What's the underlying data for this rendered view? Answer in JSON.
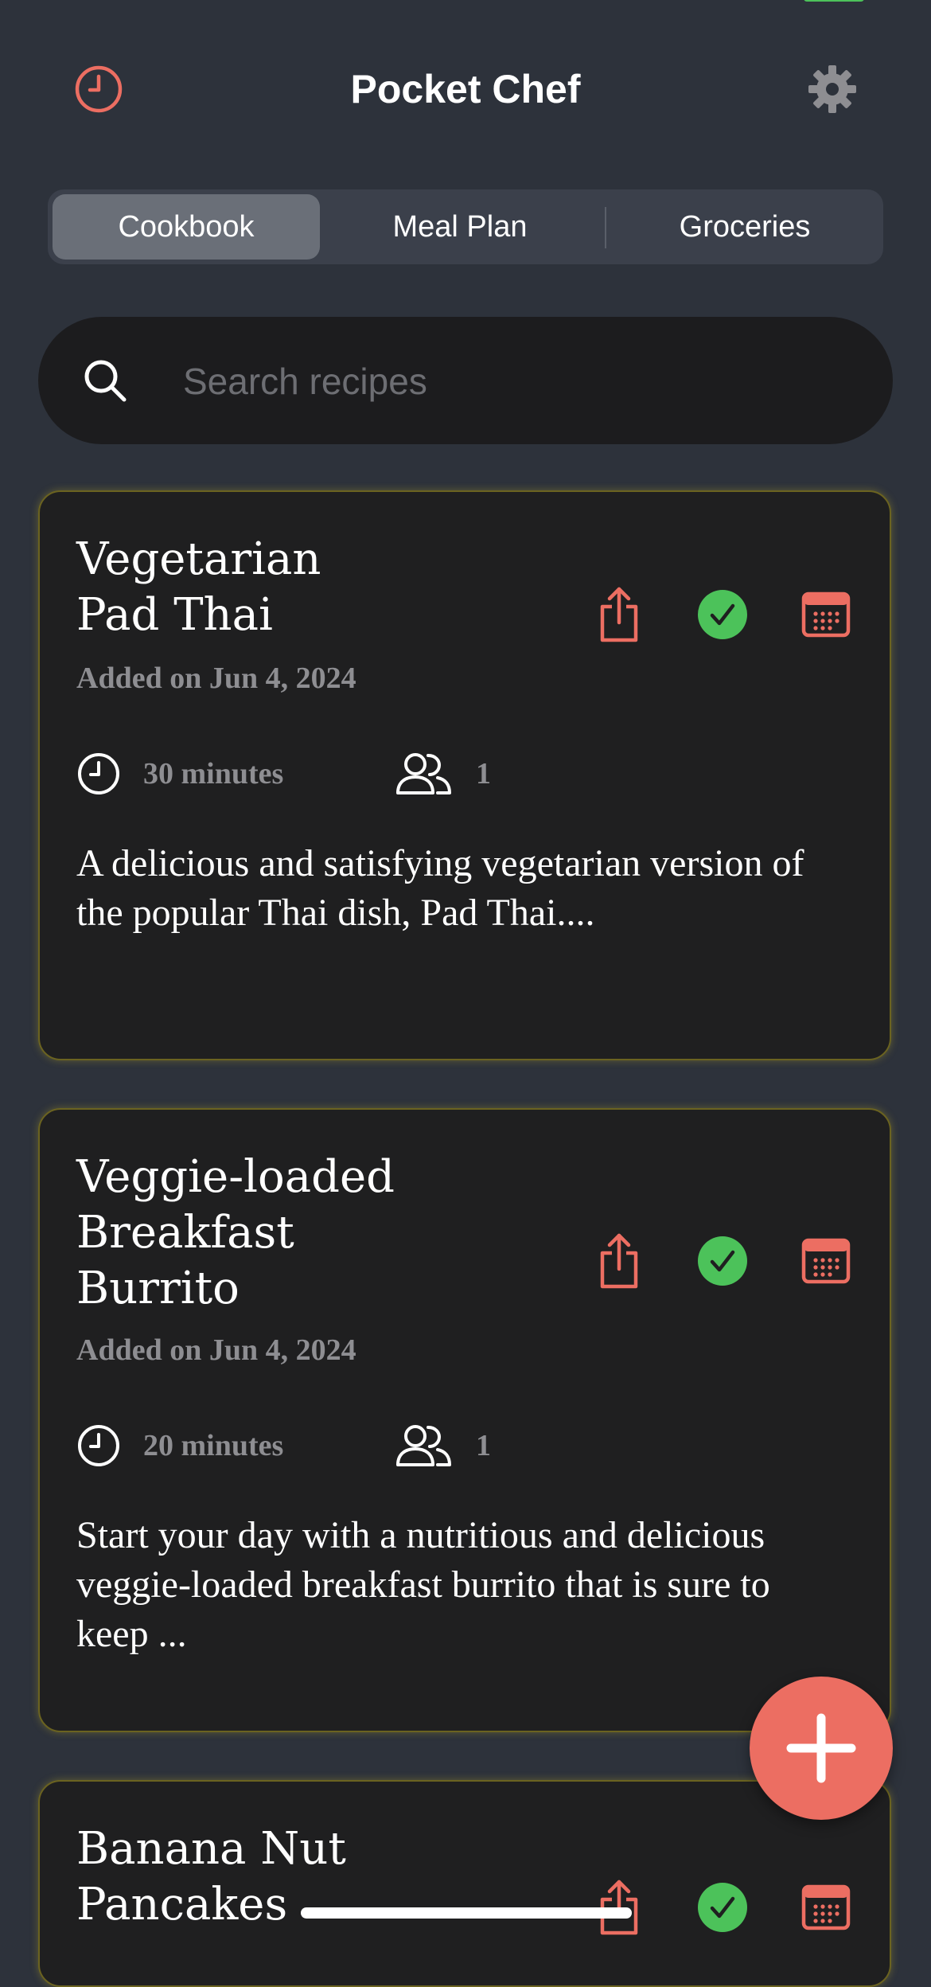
{
  "header": {
    "title": "Pocket Chef",
    "history_icon": "clock-icon",
    "settings_icon": "gear-icon"
  },
  "tabs": [
    {
      "label": "Cookbook",
      "active": true
    },
    {
      "label": "Meal Plan",
      "active": false
    },
    {
      "label": "Groceries",
      "active": false
    }
  ],
  "search": {
    "placeholder": "Search recipes",
    "value": ""
  },
  "recipes": [
    {
      "title": "Vegetarian\nPad Thai",
      "added": "Added on Jun 4, 2024",
      "time": "30 minutes",
      "servings": "1",
      "description": "A delicious and satisfying vegetarian version of the popular Thai dish, Pad Thai...."
    },
    {
      "title": "Veggie-loaded\nBreakfast\nBurrito",
      "added": "Added on Jun 4, 2024",
      "time": "20 minutes",
      "servings": "1",
      "description": "Start your day with a nutritious and delicious veggie-loaded breakfast burrito that is sure to keep ..."
    },
    {
      "title": "Banana Nut\nPancakes"
    }
  ],
  "colors": {
    "accent": "#ec6e62",
    "success": "#4cc25a",
    "card_border": "#6b6320",
    "background": "#2d323b"
  },
  "fab_icon": "plus-icon"
}
